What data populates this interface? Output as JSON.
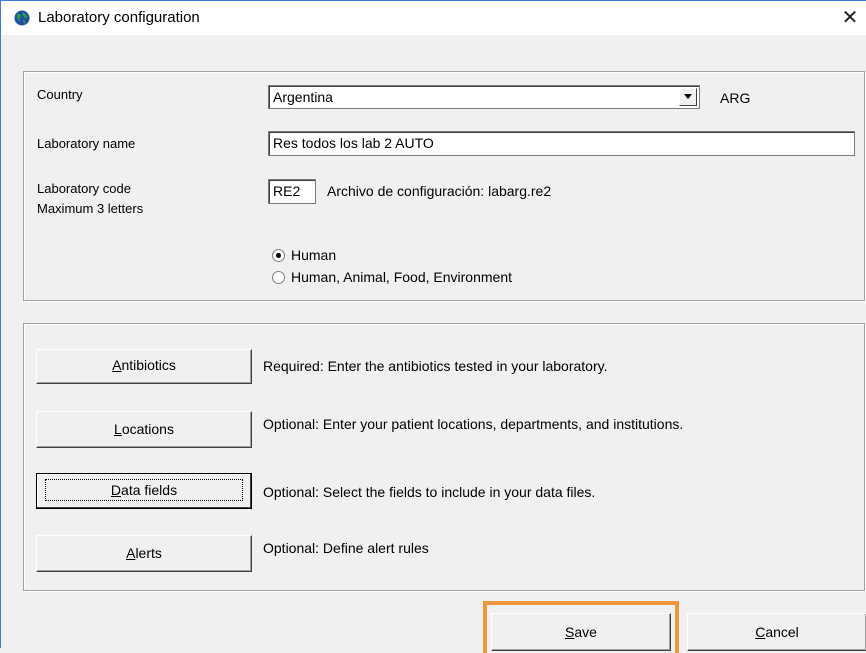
{
  "window": {
    "title": "Laboratory configuration",
    "close_glyph": "✕",
    "icon": "globe-icon"
  },
  "form": {
    "country_label": "Country",
    "country_value": "Argentina",
    "country_code": "ARG",
    "lab_name_label": "Laboratory name",
    "lab_name_value": "Res todos los lab 2 AUTO",
    "lab_code_label": "Laboratory code",
    "lab_code_hint": "Maximum 3 letters",
    "lab_code_value": "RE2",
    "config_file_text": "Archivo de configuración:  labarg.re2",
    "radio_human": "Human",
    "radio_all": "Human, Animal, Food, Environment",
    "selected_radio": "Human"
  },
  "actions": [
    {
      "key": "A",
      "rest": "ntibiotics",
      "desc": "Required:  Enter the antibiotics tested in your laboratory."
    },
    {
      "key": "L",
      "rest": "ocations",
      "desc": "Optional:  Enter your patient locations, departments, and institutions."
    },
    {
      "key": "D",
      "rest": "ata fields",
      "desc": "Optional:  Select the fields to include in your data files."
    },
    {
      "key": "A",
      "rest": "lerts",
      "desc": "Optional:  Define alert rules"
    }
  ],
  "footer": {
    "save_key": "S",
    "save_rest": "ave",
    "cancel_key": "C",
    "cancel_rest": "ancel"
  },
  "colors": {
    "highlight": "#f0963c",
    "window_border": "#3c7dd8"
  }
}
